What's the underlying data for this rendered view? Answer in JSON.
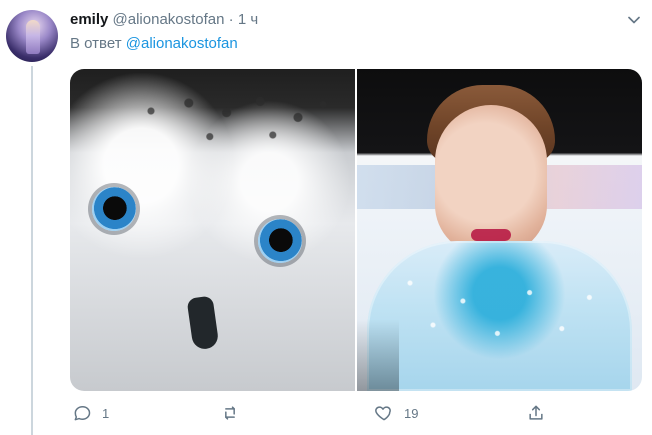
{
  "tweet": {
    "display_name": "emily",
    "handle": "@alionakostofan",
    "separator": "·",
    "time": "1 ч",
    "reply_prefix": "В ответ",
    "reply_handle": "@alionakostofan"
  },
  "actions": {
    "reply_count": "1",
    "retweet_count": "",
    "like_count": "19"
  },
  "icons": {
    "avatar": "avatar",
    "menu": "chevron-down-icon",
    "reply": "reply-icon",
    "retweet": "retweet-icon",
    "like": "like-icon",
    "share": "share-icon"
  },
  "colors": {
    "link": "#1b95e0",
    "secondary_text": "#657786",
    "thread_line": "#ccd6dd"
  }
}
